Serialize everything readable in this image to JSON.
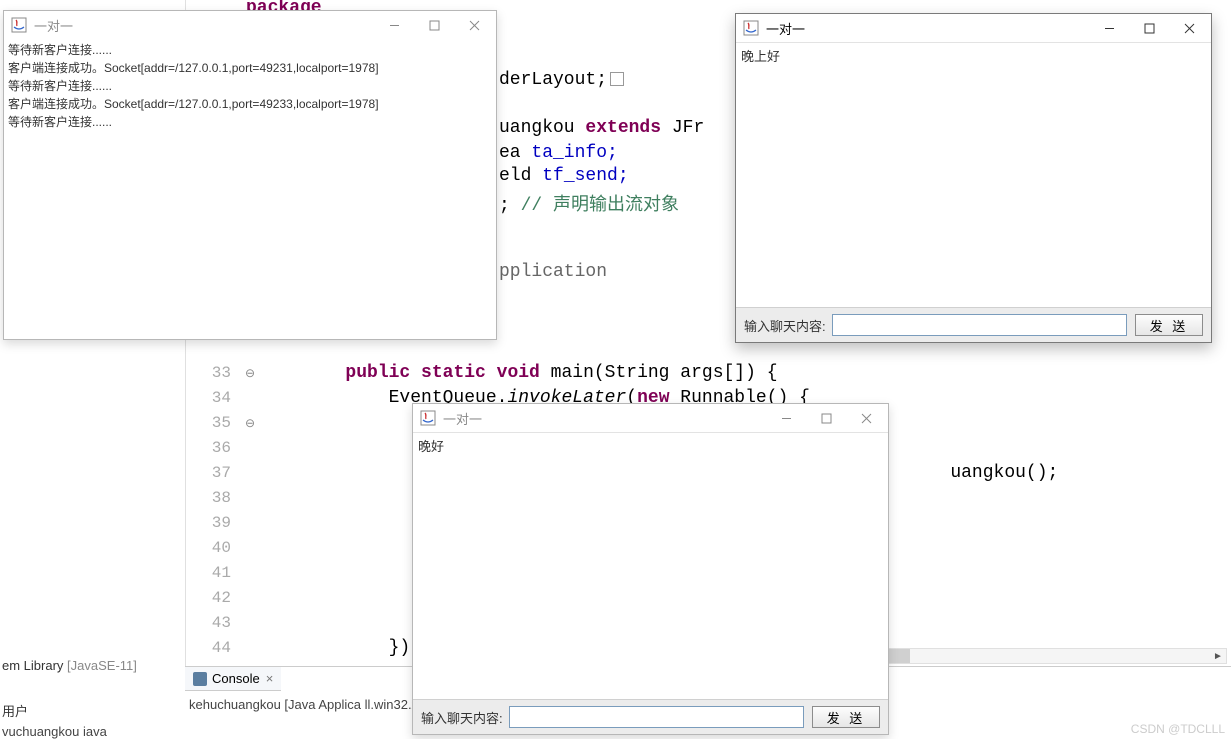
{
  "ide": {
    "library_label": "em Library ",
    "library_bracket": "[JavaSE-11]",
    "user_label": "用户",
    "file_label": "vuchuangkou iava",
    "console_tab": "Console",
    "console_line": "kehuchuangkou [Java Applica                                                                                                                                                                          ll.win32.x86_64_17.0.5.v20221102-0933\\jre"
  },
  "code": {
    "fragments": {
      "package_kw": "package",
      "border_layout": "derLayout;",
      "uangkou": "uangkou ",
      "extends": "extends",
      "jfr": " JFr",
      "ea": "ea ",
      "ta_info": "ta_info;",
      "eld": "eld ",
      "tf_send": "tf_send;",
      "semicolon": ";",
      "comment": "// 声明输出流对象",
      "application": "pplication"
    },
    "lines": [
      {
        "num": "33",
        "mark": "⊖",
        "pre": "        ",
        "kw": "public static void",
        "rest": " main(String args[]) {"
      },
      {
        "num": "34",
        "mark": "",
        "pre": "            ",
        "kw": "",
        "rest_html": "EventQueue.<span class='ital'>invokeLater</span>(<span class='kw'>new</span> Runnable() {"
      },
      {
        "num": "35",
        "mark": "⊖",
        "pre": "                ",
        "kw": "",
        "rest": ""
      },
      {
        "num": "36",
        "mark": "",
        "pre": "",
        "kw": "",
        "rest": ""
      },
      {
        "num": "37",
        "mark": "",
        "pre": "                                                                ",
        "kw": "",
        "rest": "uangkou();"
      },
      {
        "num": "38",
        "mark": "",
        "pre": "",
        "kw": "",
        "rest": ""
      },
      {
        "num": "39",
        "mark": "",
        "pre": "",
        "kw": "",
        "rest": ""
      },
      {
        "num": "40",
        "mark": "",
        "pre": "",
        "kw": "",
        "rest": ""
      },
      {
        "num": "41",
        "mark": "",
        "pre": "",
        "kw": "",
        "rest": ""
      },
      {
        "num": "42",
        "mark": "",
        "pre": "",
        "kw": "",
        "rest": ""
      },
      {
        "num": "43",
        "mark": "",
        "pre": "",
        "kw": "",
        "rest": ""
      },
      {
        "num": "44",
        "mark": "",
        "pre": "            ",
        "kw": "",
        "rest": "});"
      }
    ]
  },
  "windows": {
    "server": {
      "title": "一对一",
      "log": [
        "等待新客户连接......",
        "客户端连接成功。Socket[addr=/127.0.0.1,port=49231,localport=1978]",
        "等待新客户连接......",
        "客户端连接成功。Socket[addr=/127.0.0.1,port=49233,localport=1978]",
        "等待新客户连接......"
      ]
    },
    "client1": {
      "title": "一对一",
      "msg": "晚好",
      "input_label": "输入聊天内容:",
      "send": "发 送"
    },
    "client2": {
      "title": "一对一",
      "msg": "晚上好",
      "input_label": "输入聊天内容:",
      "send": "发 送"
    }
  },
  "watermark": "CSDN @TDCLLL"
}
